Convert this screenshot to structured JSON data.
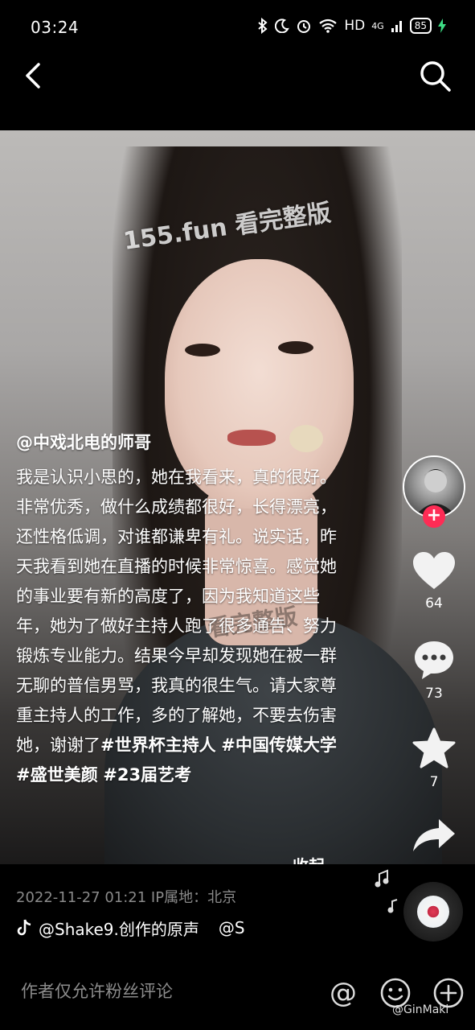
{
  "status_bar": {
    "time": "03:24",
    "network": "HD",
    "signal": "4G",
    "battery": "85"
  },
  "nav": {
    "back_icon": "chevron-left-icon",
    "search_icon": "search-icon"
  },
  "video": {
    "watermark_top": "155.fun 看完整版",
    "watermark_mid": "看完整版",
    "author": "@中戏北电的师哥",
    "caption_text": "我是认识小思的，她在我看来，真的很好。非常优秀，做什么成绩都很好，长得漂亮，还性格低调，对谁都谦卑有礼。说实话，昨天我看到她在直播的时候非常惊喜。感觉她的事业要有新的高度了，因为我知道这些年，她为了做好主持人跑了很多通告、努力锻炼专业能力。结果今早却发现她在被一群无聊的普信男骂，我真的很生气。请大家尊重主持人的工作，多的了解她，不要去伤害她，谢谢了",
    "hashtags": [
      "#世界杯主持人",
      "#中国传媒大学",
      "#盛世美颜",
      "#23届艺考"
    ],
    "collapse_label": "收起"
  },
  "rail": {
    "follow_symbol": "+",
    "like_count": "64",
    "comment_count": "73",
    "favorite_count": "7"
  },
  "meta": {
    "date_location": "2022-11-27 01:21  IP属地：北京",
    "music_label": "@Shake9.创作的原声",
    "music_extra": "@S"
  },
  "bottom_bar": {
    "comment_placeholder": "作者仅允许粉丝评论",
    "at_symbol": "@",
    "weibo_mark": "@GinMaki"
  },
  "colors": {
    "accent": "#fe2c55",
    "background": "#000000",
    "muted_text": "#8a8a8a"
  }
}
